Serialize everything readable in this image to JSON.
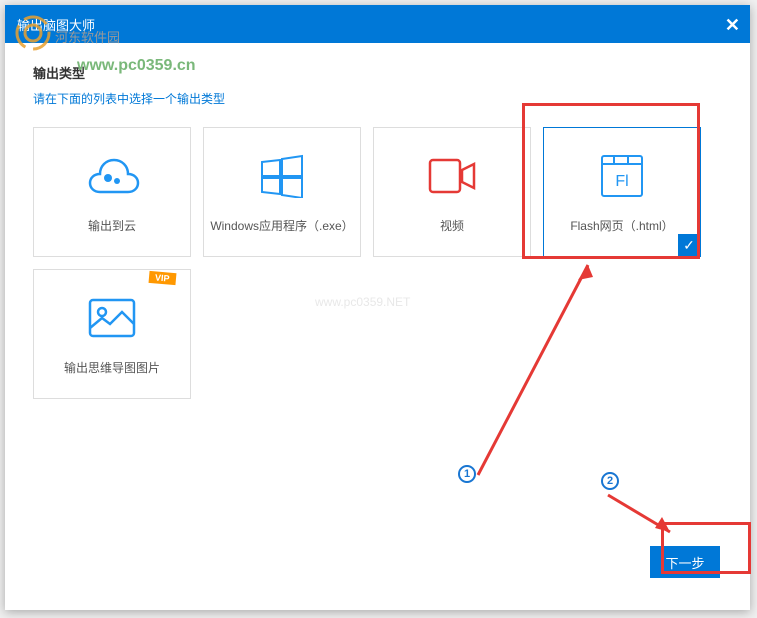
{
  "window": {
    "title": "输出脑图大师"
  },
  "watermark": {
    "logo": "河",
    "text": "河东软件园",
    "url": "www.pc0359.cn",
    "center": "www.pc0359.NET"
  },
  "section": {
    "title": "输出类型",
    "subtitle": "请在下面的列表中选择一个输出类型"
  },
  "options": [
    {
      "label": "输出到云",
      "icon": "cloud",
      "selected": false,
      "vip": false
    },
    {
      "label": "Windows应用程序（.exe）",
      "icon": "windows",
      "selected": false,
      "vip": false
    },
    {
      "label": "视频",
      "icon": "video",
      "selected": false,
      "vip": false
    },
    {
      "label": "Flash网页（.html）",
      "icon": "flash",
      "selected": true,
      "vip": false
    },
    {
      "label": "输出思维导图图片",
      "icon": "image",
      "selected": false,
      "vip": true
    }
  ],
  "buttons": {
    "next": "下一步"
  },
  "annotations": {
    "num1": "1",
    "num2": "2",
    "vip": "VIP"
  }
}
